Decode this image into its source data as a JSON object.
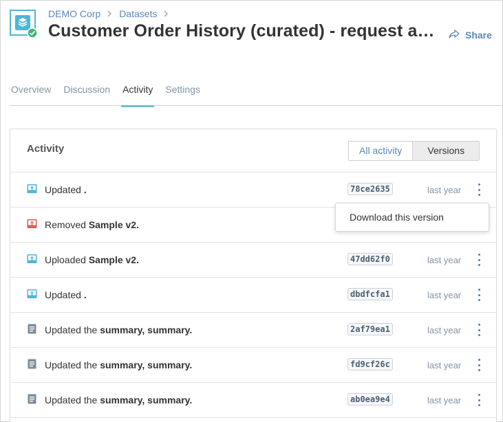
{
  "header": {
    "breadcrumb": [
      "DEMO Corp",
      "Datasets"
    ],
    "title": "Customer Order History (curated) - request acc…",
    "share_label": "Share"
  },
  "tabs": [
    {
      "label": "Overview",
      "active": false
    },
    {
      "label": "Discussion",
      "active": false
    },
    {
      "label": "Activity",
      "active": true
    },
    {
      "label": "Settings",
      "active": false
    }
  ],
  "activity": {
    "title": "Activity",
    "toggle": {
      "all": "All activity",
      "versions": "Versions",
      "selected": "Versions"
    },
    "rows": [
      {
        "icon": "upload-icon",
        "action": "Updated",
        "target": ".",
        "hash": "78ce2635",
        "time": "last year"
      },
      {
        "icon": "remove-icon",
        "action": "Removed",
        "target": "Sample v2.",
        "hash": "",
        "time": ""
      },
      {
        "icon": "upload-icon",
        "action": "Uploaded",
        "target": "Sample v2.",
        "hash": "47dd62f0",
        "time": "last year"
      },
      {
        "icon": "upload-icon",
        "action": "Updated",
        "target": ".",
        "hash": "dbdfcfa1",
        "time": "last year"
      },
      {
        "icon": "document-icon",
        "action": "Updated the",
        "target": "summary, summary.",
        "hash": "2af79ea1",
        "time": "last year"
      },
      {
        "icon": "document-icon",
        "action": "Updated the",
        "target": "summary, summary.",
        "hash": "fd9cf26c",
        "time": "last year"
      },
      {
        "icon": "document-icon",
        "action": "Updated the",
        "target": "summary, summary.",
        "hash": "ab0ea9e4",
        "time": "last year"
      }
    ]
  },
  "dropdown": {
    "item": "Download this version"
  },
  "colors": {
    "link": "#5b87b8",
    "tab_active_underline": "#6cc0cf",
    "upload_icon": "#4fb6d8",
    "remove_icon": "#e25c5c",
    "document_icon": "#7d8b99",
    "check_badge": "#3cb878"
  }
}
